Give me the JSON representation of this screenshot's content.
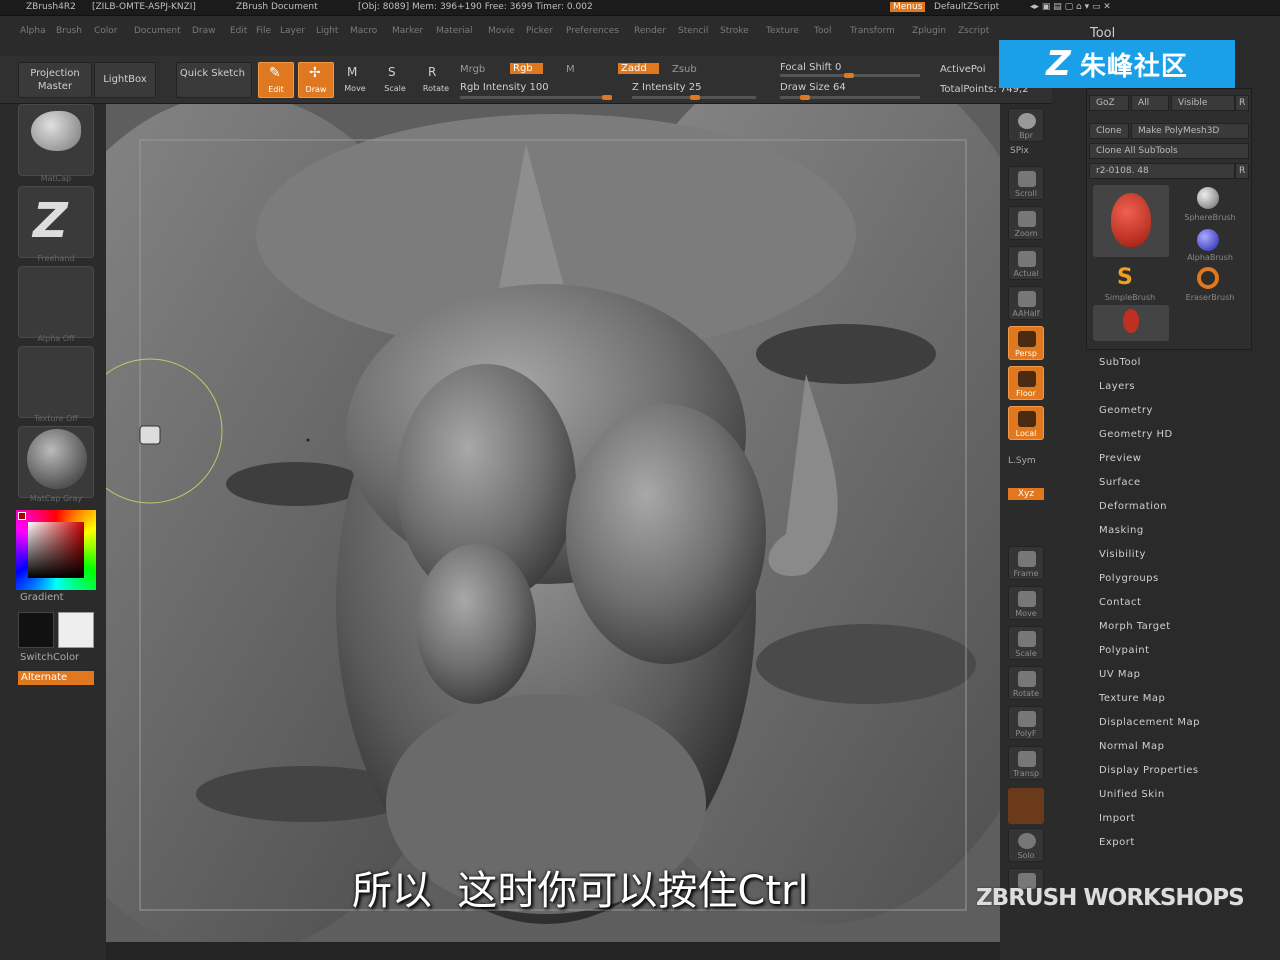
{
  "titlebar": {
    "app": "ZBrush4R2",
    "id": "[ZILB-OMTE-ASPJ-KNZI]",
    "doc": "ZBrush Document",
    "stats": "[Obj: 8089] Mem: 396+190 Free: 3699 Timer: 0.002",
    "menus_label": "Menus",
    "script_label": "DefaultZScript"
  },
  "menubar": {
    "items": [
      "Alpha",
      "Brush",
      "Color",
      "Document",
      "Draw",
      "Edit",
      "File",
      "Layer",
      "Light",
      "Macro",
      "Marker",
      "Material",
      "Movie",
      "Picker",
      "Preferences",
      "Render",
      "Stencil",
      "Stroke",
      "Texture",
      "Tool",
      "Transform",
      "Zplugin",
      "Zscript"
    ]
  },
  "toolbar": {
    "projection_master": "Projection Master",
    "lightbox": "LightBox",
    "quick_sketch": "Quick Sketch",
    "edit": "Edit",
    "draw": "Draw",
    "move": "Move",
    "scale": "Scale",
    "rotate": "Rotate",
    "mrgb": "Mrgb",
    "rgb": "Rgb",
    "m": "M",
    "rgb_intensity": "Rgb Intensity 100",
    "zadd": "Zadd",
    "zsub": "Zsub",
    "z_intensity": "Z Intensity 25",
    "focal_shift": "Focal Shift 0",
    "draw_size": "Draw Size 64",
    "active_points": "ActivePoi",
    "total_points": "TotalPoints: 749,2"
  },
  "leftshelf": {
    "items": [
      "MatCap",
      "Freehand",
      "Alpha Off",
      "Texture Off",
      "MatCap Gray"
    ],
    "gradient": "Gradient",
    "switchcolor": "SwitchColor",
    "alternate": "Alternate"
  },
  "rightshelf": {
    "items": [
      "Bpr",
      "SPix",
      "Scroll",
      "Zoom",
      "Actual",
      "AAHalf",
      "Persp",
      "Floor",
      "Local",
      "L.Sym",
      "Frame",
      "Move",
      "Scale",
      "Rotate",
      "PolyF",
      "Transp",
      "Ghost",
      "Solo"
    ],
    "xyz": "Xyz"
  },
  "toolpanel": {
    "header": "Tool",
    "goz": "GoZ",
    "all": "All",
    "visible": "Visible",
    "r": "R",
    "clone": "Clone",
    "make_polymesh": "Make PolyMesh3D",
    "clone_all": "Clone All SubTools",
    "current_tool": "r2-0108. 48",
    "brushes": [
      "SphereBrush",
      "AlphaBrush",
      "SimpleBrush",
      "EraserBrush"
    ],
    "sections": [
      "SubTool",
      "Layers",
      "Geometry",
      "Geometry HD",
      "Preview",
      "Surface",
      "Deformation",
      "Masking",
      "Visibility",
      "Polygroups",
      "Contact",
      "Morph Target",
      "Polypaint",
      "UV Map",
      "Texture Map",
      "Displacement Map",
      "Normal Map",
      "Display Properties",
      "Unified Skin",
      "Import",
      "Export"
    ]
  },
  "logo": {
    "text": "朱峰社区"
  },
  "subtitle": "所以  这时你可以按住Ctrl",
  "watermark": "ZBRUSH WORKSHOPS",
  "colors": {
    "accent": "#e07820",
    "logo_bg": "#1aa0e8"
  }
}
